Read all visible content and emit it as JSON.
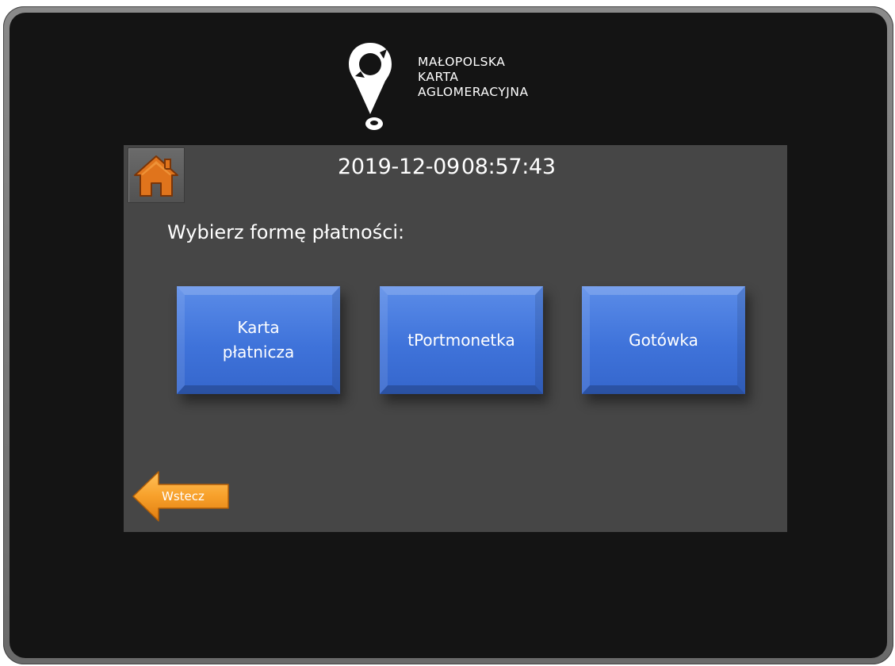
{
  "brand": {
    "logo_icon": "map-pin-logo-icon",
    "name_lines": [
      "MAŁOPOLSKA",
      "KARTA",
      "AGLOMERACYJNA"
    ]
  },
  "header": {
    "home_icon": "home-icon",
    "date": "2019-12-09",
    "time": "08:57:43"
  },
  "main": {
    "prompt": "Wybierz formę płatności:",
    "payment_options": [
      {
        "label": "Karta\npłatnicza"
      },
      {
        "label": "tPortmonetka"
      },
      {
        "label": "Gotówka"
      }
    ]
  },
  "footer": {
    "back_label": "Wstecz",
    "back_icon": "arrow-left-icon"
  },
  "colors": {
    "bezel": "#141414",
    "panel": "#464646",
    "button_blue": "#4377de",
    "accent_orange": "#f39a1e"
  }
}
